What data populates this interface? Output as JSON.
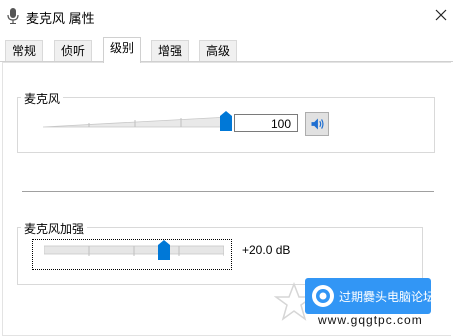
{
  "window": {
    "title": "麦克风 属性",
    "close_icon": "close-icon"
  },
  "tabs": [
    {
      "label": "常规",
      "active": false
    },
    {
      "label": "侦听",
      "active": false
    },
    {
      "label": "级别",
      "active": true
    },
    {
      "label": "增强",
      "active": false
    },
    {
      "label": "高级",
      "active": false
    }
  ],
  "microphone": {
    "group_label": "麦克风",
    "level_value": "100",
    "level_fraction": 1.0,
    "speaker_icon": "speaker-icon",
    "accent": "#0078d7"
  },
  "boost": {
    "group_label": "麦克风加强",
    "value_text": "+20.0 dB",
    "level_fraction": 0.667
  },
  "watermark": {
    "text": "过期爨头电脑论坛",
    "url": "www.gqgtpc.com",
    "color": "#3296f5"
  }
}
